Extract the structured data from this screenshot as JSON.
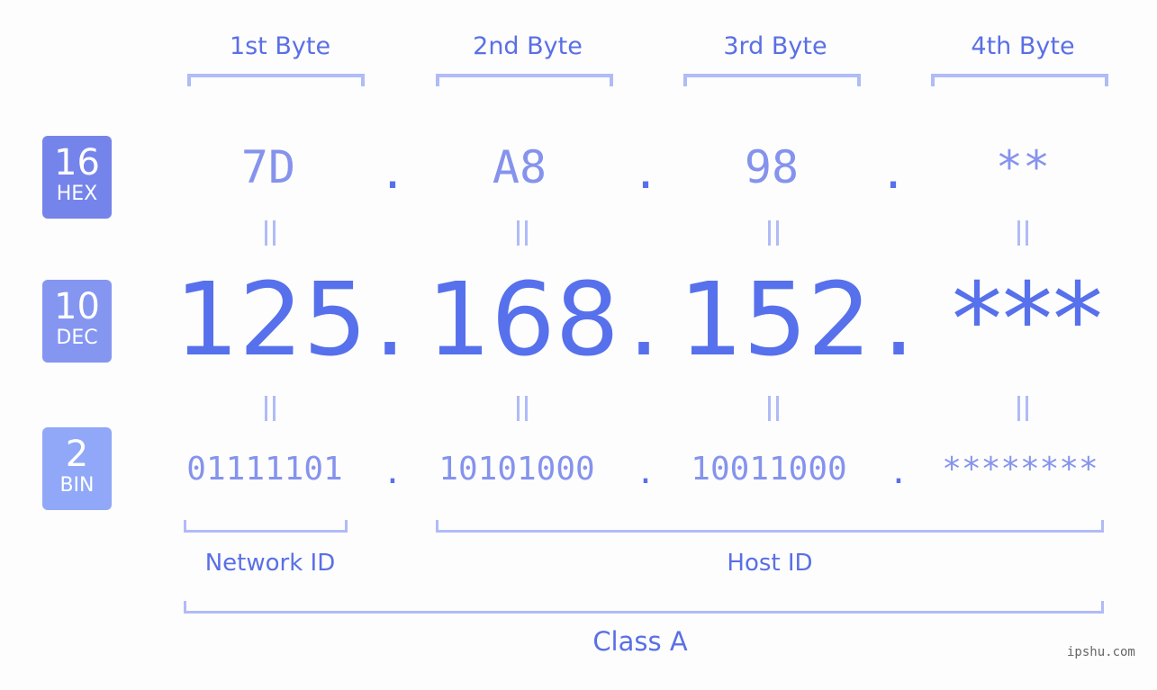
{
  "byte_headers": [
    "1st Byte",
    "2nd Byte",
    "3rd Byte",
    "4th Byte"
  ],
  "badges": [
    {
      "number": "16",
      "base": "HEX",
      "color": "#7584ea"
    },
    {
      "number": "10",
      "base": "DEC",
      "color": "#8596f1"
    },
    {
      "number": "2",
      "base": "BIN",
      "color": "#90a8f7"
    }
  ],
  "hex": {
    "octets": [
      "7D",
      "A8",
      "98",
      "**"
    ],
    "separator": "."
  },
  "dec": {
    "octets": [
      "125",
      "168",
      "152",
      "***"
    ],
    "separator": "."
  },
  "bin": {
    "octets": [
      "01111101",
      "10101000",
      "10011000",
      "********"
    ],
    "separator": "."
  },
  "sections": {
    "network_id": "Network ID",
    "host_id": "Host ID",
    "class": "Class A"
  },
  "watermark": "ipshu.com",
  "colors": {
    "primary": "#5770ec",
    "light": "#8593ee",
    "bracket": "#b0bbf7",
    "background": "#fcfdfc"
  }
}
